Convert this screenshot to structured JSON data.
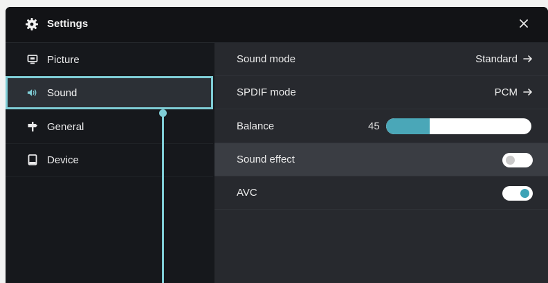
{
  "window": {
    "title": "Settings"
  },
  "colors": {
    "accent": "#7fcdd6",
    "slider_fill": "#4aa7b8",
    "toggle_on": "#3ea3b6"
  },
  "sidebar": {
    "items": [
      {
        "label": "Picture",
        "icon": "monitor-icon",
        "active": false
      },
      {
        "label": "Sound",
        "icon": "speaker-icon",
        "active": true
      },
      {
        "label": "General",
        "icon": "signpost-icon",
        "active": false
      },
      {
        "label": "Device",
        "icon": "tablet-icon",
        "active": false
      }
    ]
  },
  "settings": {
    "sound_mode": {
      "label": "Sound mode",
      "value": "Standard"
    },
    "spdif_mode": {
      "label": "SPDIF mode",
      "value": "PCM"
    },
    "balance": {
      "label": "Balance",
      "value": "45",
      "fraction": 0.3
    },
    "sound_effect": {
      "label": "Sound effect",
      "on": false
    },
    "avc": {
      "label": "AVC",
      "on": true
    }
  }
}
